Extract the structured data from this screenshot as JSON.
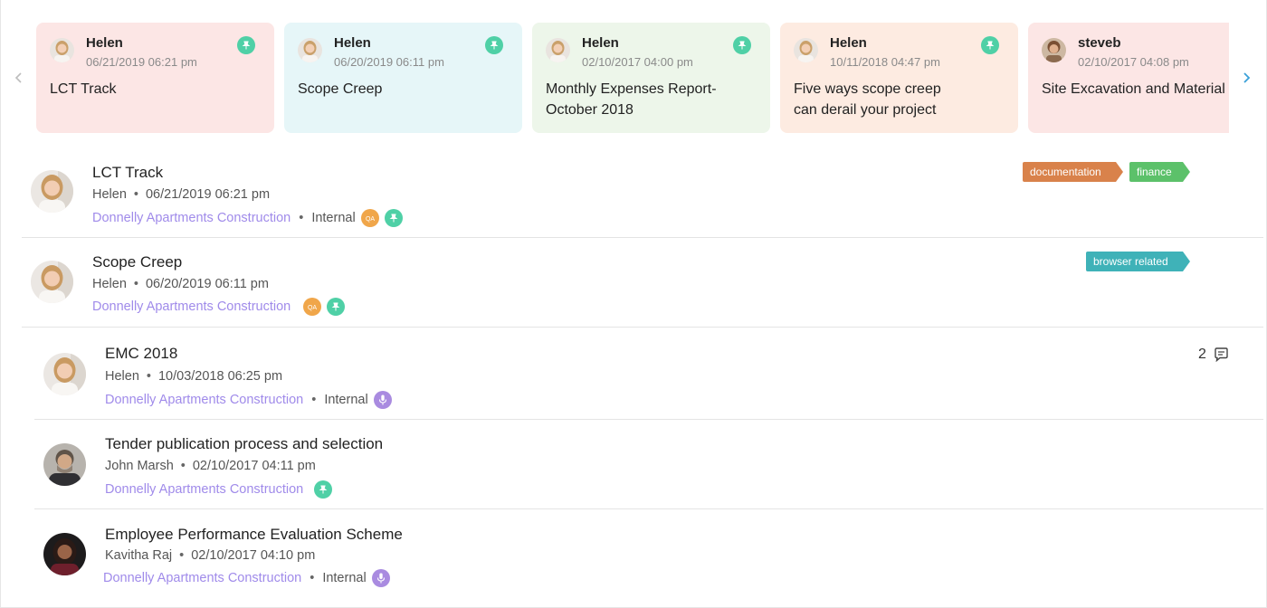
{
  "carousel": {
    "cards": [
      {
        "author": "Helen",
        "date": "06/21/2019 06:21 pm",
        "title": "LCT Track",
        "bg": "#fce6e5"
      },
      {
        "author": "Helen",
        "date": "06/20/2019 06:11 pm",
        "title": "Scope Creep",
        "bg": "#e6f6f8"
      },
      {
        "author": "Helen",
        "date": "02/10/2017 04:00 pm",
        "title": "Monthly Expenses Report-\nOctober 2018",
        "bg": "#edf6ea"
      },
      {
        "author": "Helen",
        "date": "10/11/2018 04:47 pm",
        "title": "Five ways scope creep\n can derail  your project",
        "bg": "#fdebe1"
      },
      {
        "author": "steveb",
        "date": "02/10/2017 04:08 pm",
        "title": "Site Excavation and Material",
        "bg": "#fce6e5"
      }
    ]
  },
  "list": [
    {
      "title": "LCT Track",
      "author": "Helen",
      "date": "06/21/2019 06:21 pm",
      "project": "Donnelly Apartments Construction",
      "visibility": "Internal",
      "tags": [
        {
          "label": "documentation",
          "color": "#d9824b"
        },
        {
          "label": "finance",
          "color": "#5cc16a"
        }
      ]
    },
    {
      "title": "Scope Creep",
      "author": "Helen",
      "date": "06/20/2019 06:11 pm",
      "project": "Donnelly Apartments Construction",
      "visibility": "",
      "tags": [
        {
          "label": "browser related",
          "color": "#3fb2b8"
        }
      ]
    },
    {
      "title": "EMC 2018",
      "author": "Helen",
      "date": "10/03/2018 06:25 pm",
      "project": "Donnelly Apartments Construction",
      "visibility": "Internal",
      "comments": "2"
    },
    {
      "title": "Tender publication process and selection",
      "author": "John Marsh",
      "date": "02/10/2017 04:11 pm",
      "project": "Donnelly Apartments Construction",
      "visibility": ""
    },
    {
      "title": "Employee Performance Evaluation Scheme",
      "author": "Kavitha Raj",
      "date": "02/10/2017 04:10 pm",
      "project": "Donnelly Apartments Construction",
      "visibility": "Internal"
    }
  ],
  "badges": {
    "qa_label": "QA"
  },
  "colors": {
    "project_link": "#a08bea",
    "pin": "#4fd0a6",
    "qa": "#f0a64a",
    "mic": "#a98be0"
  },
  "icons": [
    "chevron-left-icon",
    "chevron-right-icon",
    "pin-icon",
    "qa-badge",
    "mic-icon",
    "comment-icon"
  ]
}
